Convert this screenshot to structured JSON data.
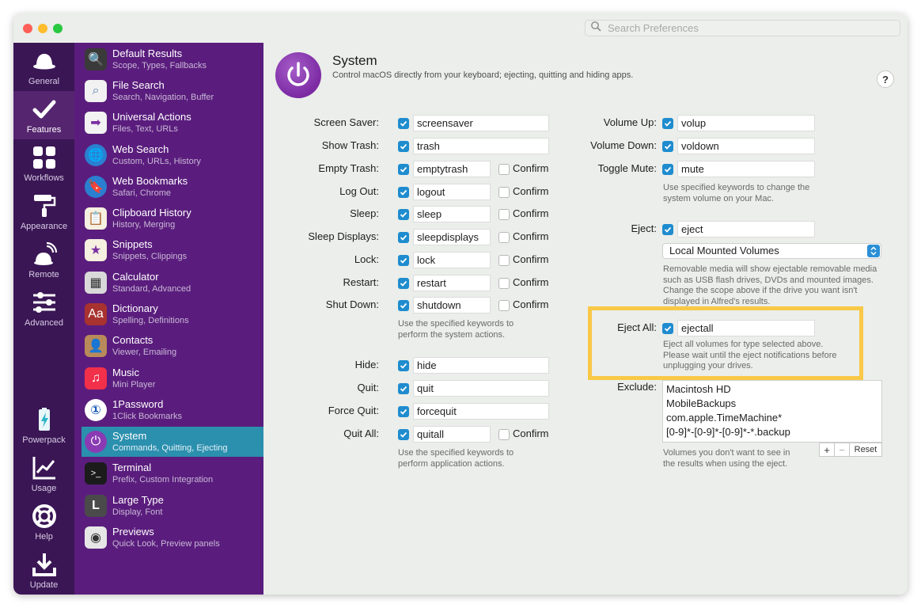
{
  "search": {
    "placeholder": "Search Preferences"
  },
  "nav": [
    {
      "label": "General"
    },
    {
      "label": "Features"
    },
    {
      "label": "Workflows"
    },
    {
      "label": "Appearance"
    },
    {
      "label": "Remote"
    },
    {
      "label": "Advanced"
    },
    {
      "label": "Powerpack"
    },
    {
      "label": "Usage"
    },
    {
      "label": "Help"
    },
    {
      "label": "Update"
    }
  ],
  "features": [
    {
      "title": "Default Results",
      "sub": "Scope, Types, Fallbacks"
    },
    {
      "title": "File Search",
      "sub": "Search, Navigation, Buffer"
    },
    {
      "title": "Universal Actions",
      "sub": "Files, Text, URLs"
    },
    {
      "title": "Web Search",
      "sub": "Custom, URLs, History"
    },
    {
      "title": "Web Bookmarks",
      "sub": "Safari, Chrome"
    },
    {
      "title": "Clipboard History",
      "sub": "History, Merging"
    },
    {
      "title": "Snippets",
      "sub": "Snippets, Clippings"
    },
    {
      "title": "Calculator",
      "sub": "Standard, Advanced"
    },
    {
      "title": "Dictionary",
      "sub": "Spelling, Definitions"
    },
    {
      "title": "Contacts",
      "sub": "Viewer, Emailing"
    },
    {
      "title": "Music",
      "sub": "Mini Player"
    },
    {
      "title": "1Password",
      "sub": "1Click Bookmarks"
    },
    {
      "title": "System",
      "sub": "Commands, Quitting, Ejecting"
    },
    {
      "title": "Terminal",
      "sub": "Prefix, Custom Integration"
    },
    {
      "title": "Large Type",
      "sub": "Display, Font"
    },
    {
      "title": "Previews",
      "sub": "Quick Look, Preview panels"
    }
  ],
  "header": {
    "title": "System",
    "subtitle": "Control macOS directly from your keyboard; ejecting, quitting and hiding apps.",
    "help": "?"
  },
  "confirm_label": "Confirm",
  "system_rows": [
    {
      "label": "Screen Saver:",
      "value": "screensaver"
    },
    {
      "label": "Show Trash:",
      "value": "trash"
    },
    {
      "label": "Empty Trash:",
      "value": "emptytrash"
    },
    {
      "label": "Log Out:",
      "value": "logout"
    },
    {
      "label": "Sleep:",
      "value": "sleep"
    },
    {
      "label": "Sleep Displays:",
      "value": "sleepdisplays"
    },
    {
      "label": "Lock:",
      "value": "lock"
    },
    {
      "label": "Restart:",
      "value": "restart"
    },
    {
      "label": "Shut Down:",
      "value": "shutdown"
    }
  ],
  "system_note": [
    "Use the specified keywords to",
    "perform the system actions."
  ],
  "app_rows": [
    {
      "label": "Hide:",
      "value": "hide"
    },
    {
      "label": "Quit:",
      "value": "quit"
    },
    {
      "label": "Force Quit:",
      "value": "forcequit"
    },
    {
      "label": "Quit All:",
      "value": "quitall"
    }
  ],
  "app_note": [
    "Use the specified keywords to",
    "perform application actions."
  ],
  "volume_rows": [
    {
      "label": "Volume Up:",
      "value": "volup"
    },
    {
      "label": "Volume Down:",
      "value": "voldown"
    },
    {
      "label": "Toggle Mute:",
      "value": "mute"
    }
  ],
  "volume_note": [
    "Use specified keywords to change the",
    "system volume on your Mac."
  ],
  "eject": {
    "label": "Eject:",
    "value": "eject",
    "scope": "Local Mounted Volumes",
    "note": [
      "Removable media will show ejectable removable media",
      "such as USB flash drives, DVDs and mounted images.",
      "Change the scope above if the drive you want isn't",
      "displayed in Alfred's results."
    ]
  },
  "eject_all": {
    "label": "Eject All:",
    "value": "ejectall",
    "note": [
      "Eject all volumes for type selected above.",
      "Please wait until the eject notifications before",
      "unplugging your drives."
    ]
  },
  "exclude": {
    "label": "Exclude:",
    "items": [
      "Macintosh HD",
      "MobileBackups",
      "com.apple.TimeMachine*",
      "[0-9]*-[0-9]*-[0-9]*-*.backup"
    ],
    "add": "+",
    "remove": "−",
    "reset": "Reset",
    "note": [
      "Volumes you don't want to see in",
      "the results when using the eject."
    ]
  },
  "colors": {
    "nav_bg": "#3a1655",
    "features_bg": "#5a1d7d",
    "selected_row": "#2b8fae",
    "checkbox": "#1e8ccf",
    "highlight": "#f9c846"
  }
}
